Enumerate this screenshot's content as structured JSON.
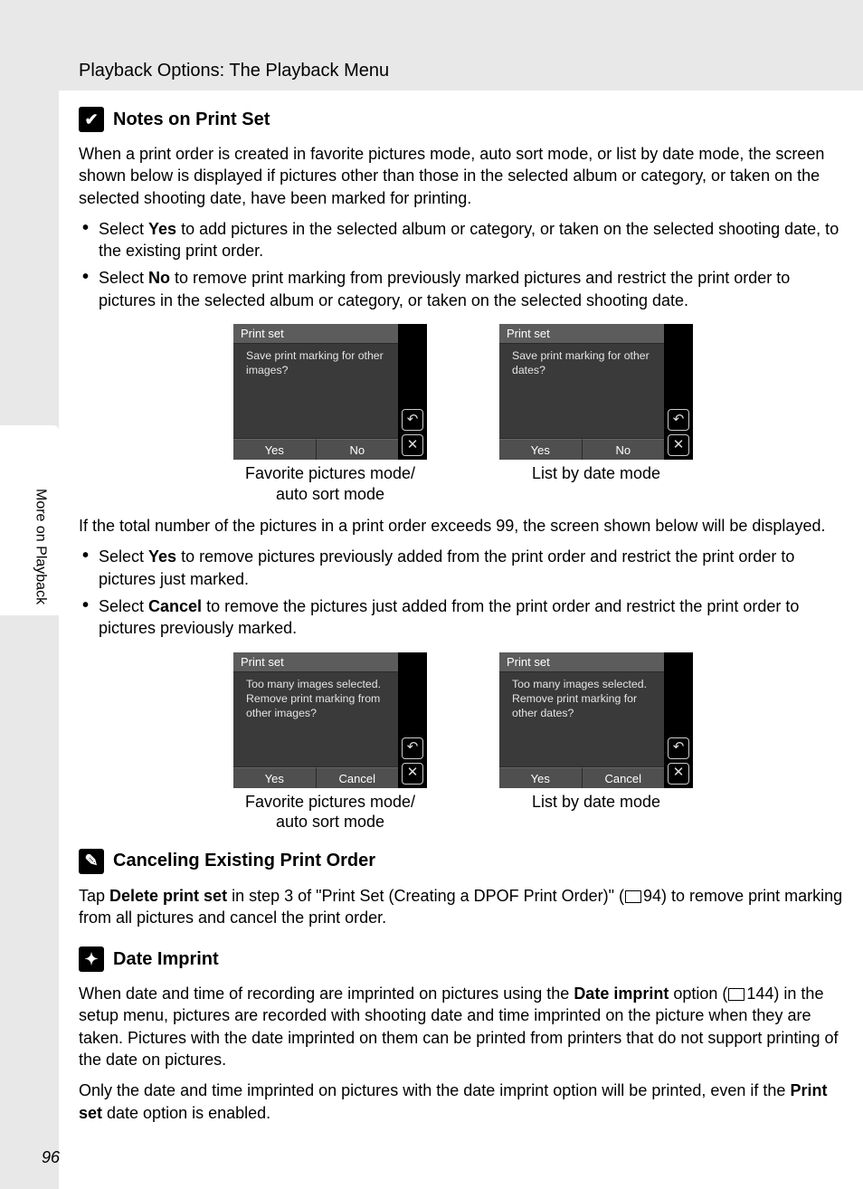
{
  "page": {
    "section_title": "Playback Options: The Playback Menu",
    "side_label": "More on Playback",
    "page_number": "96"
  },
  "notes": {
    "heading": "Notes on Print Set",
    "intro": "When a print order is created in favorite pictures mode, auto sort mode, or list by date mode, the screen shown below is displayed if pictures other than those in the selected album or category, or taken on the selected shooting date, have been marked for printing.",
    "bullet1_pre": "Select ",
    "bullet1_bold": "Yes",
    "bullet1_post": " to add pictures in the selected album or category, or taken on the selected shooting date, to the existing print order.",
    "bullet2_pre": "Select ",
    "bullet2_bold": "No",
    "bullet2_post": " to remove print marking from previously marked pictures and restrict the print order to pictures in the selected album or category, or taken on the selected shooting date.",
    "screen1": {
      "title": "Print set",
      "msg": "Save print marking for other images?",
      "btn_yes": "Yes",
      "btn_no": "No",
      "caption_l1": "Favorite pictures mode/",
      "caption_l2": "auto sort mode"
    },
    "screen2": {
      "title": "Print set",
      "msg": "Save print marking for other dates?",
      "btn_yes": "Yes",
      "btn_no": "No",
      "caption": "List by date mode"
    },
    "mid_para": "If the total number of the pictures in a print order exceeds 99, the screen shown below will be displayed.",
    "bullet3_pre": "Select ",
    "bullet3_bold": "Yes",
    "bullet3_post": " to remove pictures previously added from the print order and restrict the print order to pictures just marked.",
    "bullet4_pre": "Select ",
    "bullet4_bold": "Cancel",
    "bullet4_post": " to remove the pictures just added from the print order and restrict the print order to pictures previously marked.",
    "screen3": {
      "title": "Print set",
      "msg": "Too many images selected. Remove print marking from other images?",
      "btn_yes": "Yes",
      "btn_cancel": "Cancel",
      "caption_l1": "Favorite pictures mode/",
      "caption_l2": "auto sort mode"
    },
    "screen4": {
      "title": "Print set",
      "msg": "Too many images selected. Remove print marking for other dates?",
      "btn_yes": "Yes",
      "btn_cancel": "Cancel",
      "caption": "List by date mode"
    }
  },
  "cancel": {
    "heading": "Canceling Existing Print Order",
    "p1_a": "Tap ",
    "p1_bold": "Delete print set",
    "p1_b": " in step 3 of \"Print Set (Creating a DPOF Print Order)\" (",
    "p1_ref": "94",
    "p1_c": ") to remove print marking from all pictures and cancel the print order."
  },
  "dateimprint": {
    "heading": "Date Imprint",
    "p1_a": "When date and time of recording are imprinted on pictures using the ",
    "p1_bold": "Date imprint",
    "p1_b": " option (",
    "p1_ref": "144",
    "p1_c": ") in the setup menu, pictures are recorded with shooting date and time imprinted on the picture when they are taken. Pictures with the date imprinted on them can be printed from printers that do not support printing of the date on pictures.",
    "p2_a": "Only the date and time imprinted on pictures with the date imprint option will be printed, even if the ",
    "p2_bold": "Print set",
    "p2_b": " date option is enabled."
  },
  "icons": {
    "undo": "↶",
    "close": "✕",
    "check": "✔",
    "pencil": "✎",
    "gear": "✦"
  }
}
